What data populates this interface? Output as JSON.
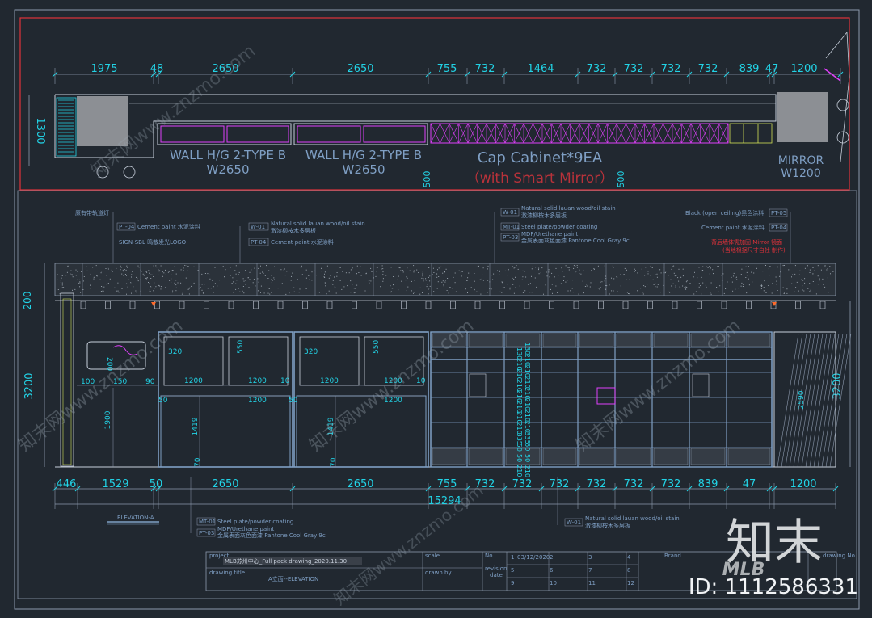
{
  "plan": {
    "top_dims": [
      "1975",
      "48",
      "2650",
      "2650",
      "755",
      "732",
      "1464",
      "732",
      "732",
      "732",
      "732",
      "839",
      "47",
      "1200"
    ],
    "left_dim": "1300",
    "wall1": {
      "title": "WALL H/G 2-TYPE B",
      "width": "W2650"
    },
    "wall2": {
      "title": "WALL H/G 2-TYPE B",
      "width": "W2650"
    },
    "cap_title": "Cap Cabinet*9EA",
    "cap_sub": "（with Smart Mirror）",
    "mirror_title": "MIRROR",
    "mirror_width": "W1200",
    "small_500a": "500",
    "small_500b": "500"
  },
  "elevation": {
    "left_dims": [
      "200",
      "3200"
    ],
    "right_dim": "3200",
    "bottom_dims": [
      "446",
      "1529",
      "50",
      "2650",
      "2650",
      "755",
      "732",
      "732",
      "732",
      "732",
      "732",
      "732",
      "839",
      "47",
      "1200"
    ],
    "total": "15294",
    "title": "ELEVATION-A",
    "inner_dims": {
      "d320a": "320",
      "d550a": "550",
      "d1200a": "1200",
      "d1200b": "1200",
      "d50a": "50",
      "d1419a": "1419",
      "d70a": "70",
      "d10a": "10",
      "d320b": "320",
      "d550b": "550",
      "d1200c": "1200",
      "d1200d": "1200",
      "d50b": "50",
      "d1419b": "1419",
      "d70b": "70",
      "d10b": "10",
      "d1900": "1900",
      "d150": "150",
      "d90": "90",
      "d100": "100",
      "d2590": "2590"
    },
    "stack_dims": [
      "130",
      "210",
      "210",
      "210",
      "210",
      "210",
      "210",
      "210",
      "335",
      "50",
      "50",
      "210"
    ]
  },
  "callouts": {
    "left": [
      {
        "code": "",
        "text": "原有带轨道灯"
      },
      {
        "code": "PT-04",
        "text": "Cement paint 水泥涂料"
      },
      {
        "code": "",
        "text": "SIGN-SBL 鸣散发光LOGO"
      }
    ],
    "mid": [
      {
        "code": "W-01",
        "text": "Natural solid lauan wood/oil stain"
      },
      {
        "code": "",
        "text": "激漆柳桉木多层板"
      },
      {
        "code": "PT-04",
        "text": "Cement paint 水泥涂料"
      }
    ],
    "center": [
      {
        "code": "W-01",
        "text": "Natural solid lauan wood/oil stain"
      },
      {
        "code": "",
        "text": "激漆柳桉木多层板"
      },
      {
        "code": "MT-01",
        "text": "Steel plate/powder coating"
      },
      {
        "code": "PT-03",
        "text": "MDF/Urethane paint"
      },
      {
        "code": "",
        "text": "金属表面灰色面漆 Pantone Cool Gray 9c"
      }
    ],
    "right": [
      {
        "code": "PT-05",
        "text": "Black (open ceiling)黑色涂料"
      },
      {
        "code": "PT-04",
        "text": "Cement paint 水泥涂料"
      },
      {
        "code": "",
        "text": "背后墙体需加固 Mirror 镜面"
      },
      {
        "code": "",
        "text": "(当地根据尺寸自社 制作)"
      }
    ],
    "bottom_left": [
      {
        "code": "MT-01",
        "text": "Steel plate/powder coating"
      },
      {
        "code": "",
        "text": "MDF/Urethane paint"
      },
      {
        "code": "PT-03",
        "text": "金属表面灰色面漆 Pantone Cool Gray 9c"
      }
    ],
    "bottom_mid": [
      {
        "code": "W-01",
        "text": "Natural solid lauan wood/oil stain"
      },
      {
        "code": "",
        "text": "激漆柳桉木多层板"
      }
    ]
  },
  "title_block": {
    "project_label": "project",
    "project_value": "MLB苏州中心_Full pack drawing_2020.11.30",
    "drawing_title_label": "drawing title",
    "drawing_title_value": "A立面--ELEVATION",
    "scale_label": "scale",
    "drawn_by_label": "drawn by",
    "no_label": "No",
    "revision_label": "revision",
    "date_label": "date",
    "date_value": "03/12/2020",
    "rev_nums": [
      "1",
      "2",
      "3",
      "4",
      "5",
      "6",
      "7",
      "8",
      "9",
      "10",
      "11",
      "12"
    ],
    "brand_label": "Brand",
    "drawing_no_label": "drawing No."
  },
  "watermark": {
    "logo_text": "知末",
    "sub": "MLB",
    "id_text": "ID: 1112586331",
    "diag": "知末网www.znzmo.com"
  }
}
